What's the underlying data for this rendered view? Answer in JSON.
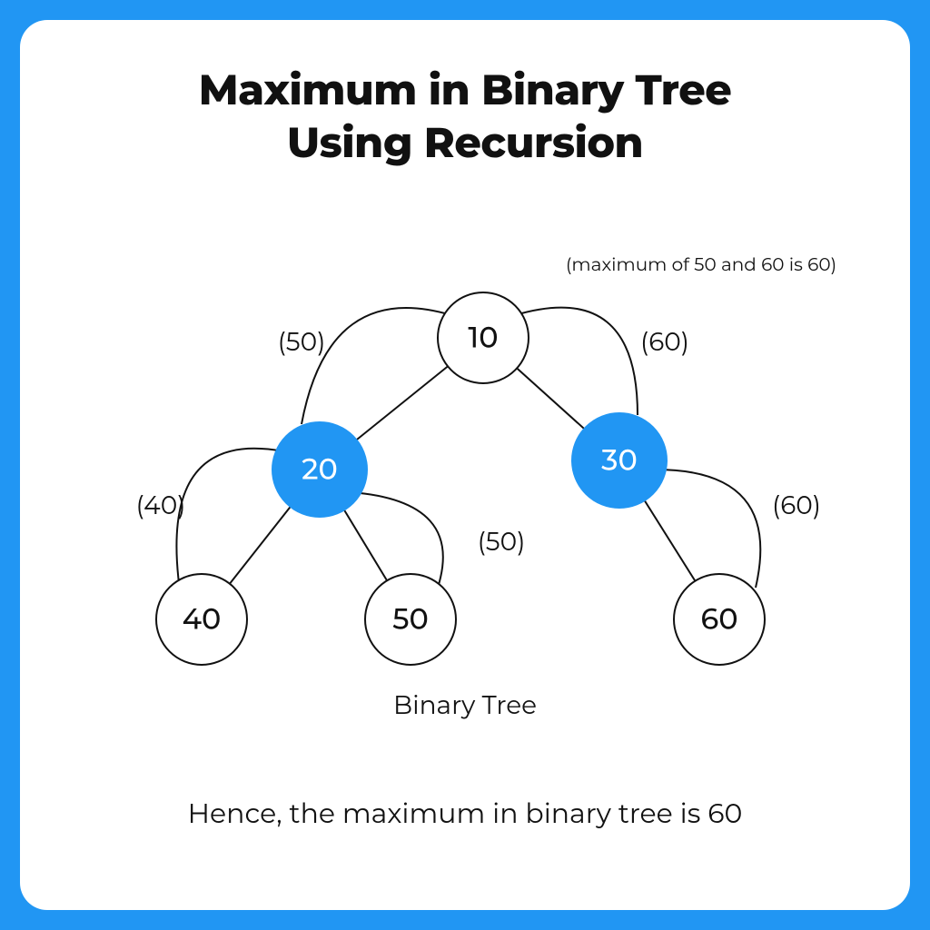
{
  "title_line1": "Maximum in Binary Tree",
  "title_line2": "Using Recursion",
  "top_note": "(maximum of 50 and 60 is 60)",
  "nodes": {
    "root": "10",
    "left": "20",
    "right": "30",
    "ll": "40",
    "lr": "50",
    "rr": "60"
  },
  "edge_labels": {
    "root_left": "(50)",
    "root_right": "(60)",
    "left_ll": "(40)",
    "left_lr": "(50)",
    "right_rr": "(60)"
  },
  "caption": "Binary Tree",
  "conclusion": "Hence, the maximum in binary tree is 60",
  "colors": {
    "accent": "#2196f3",
    "stroke": "#111"
  }
}
